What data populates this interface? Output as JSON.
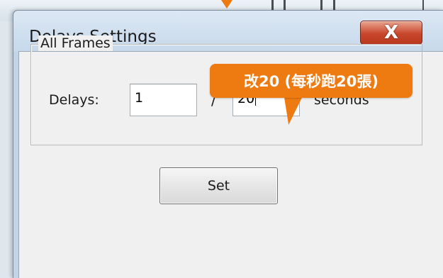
{
  "window": {
    "title": "Delays Settings",
    "close_glyph": "X"
  },
  "group": {
    "label": "All Frames"
  },
  "delays": {
    "label": "Delays:",
    "numerator": "1",
    "separator": "/",
    "denominator": "20",
    "unit_label": "seconds"
  },
  "buttons": {
    "set_label": "Set"
  },
  "callout": {
    "text": "改20 (每秒跑20張)"
  },
  "colors": {
    "callout": "#ee7b12",
    "close_button": "#c8472c",
    "titlebar": "#c6d8ea"
  },
  "icons": {
    "close": "close-icon",
    "pointer": "arrow-down-icon"
  }
}
